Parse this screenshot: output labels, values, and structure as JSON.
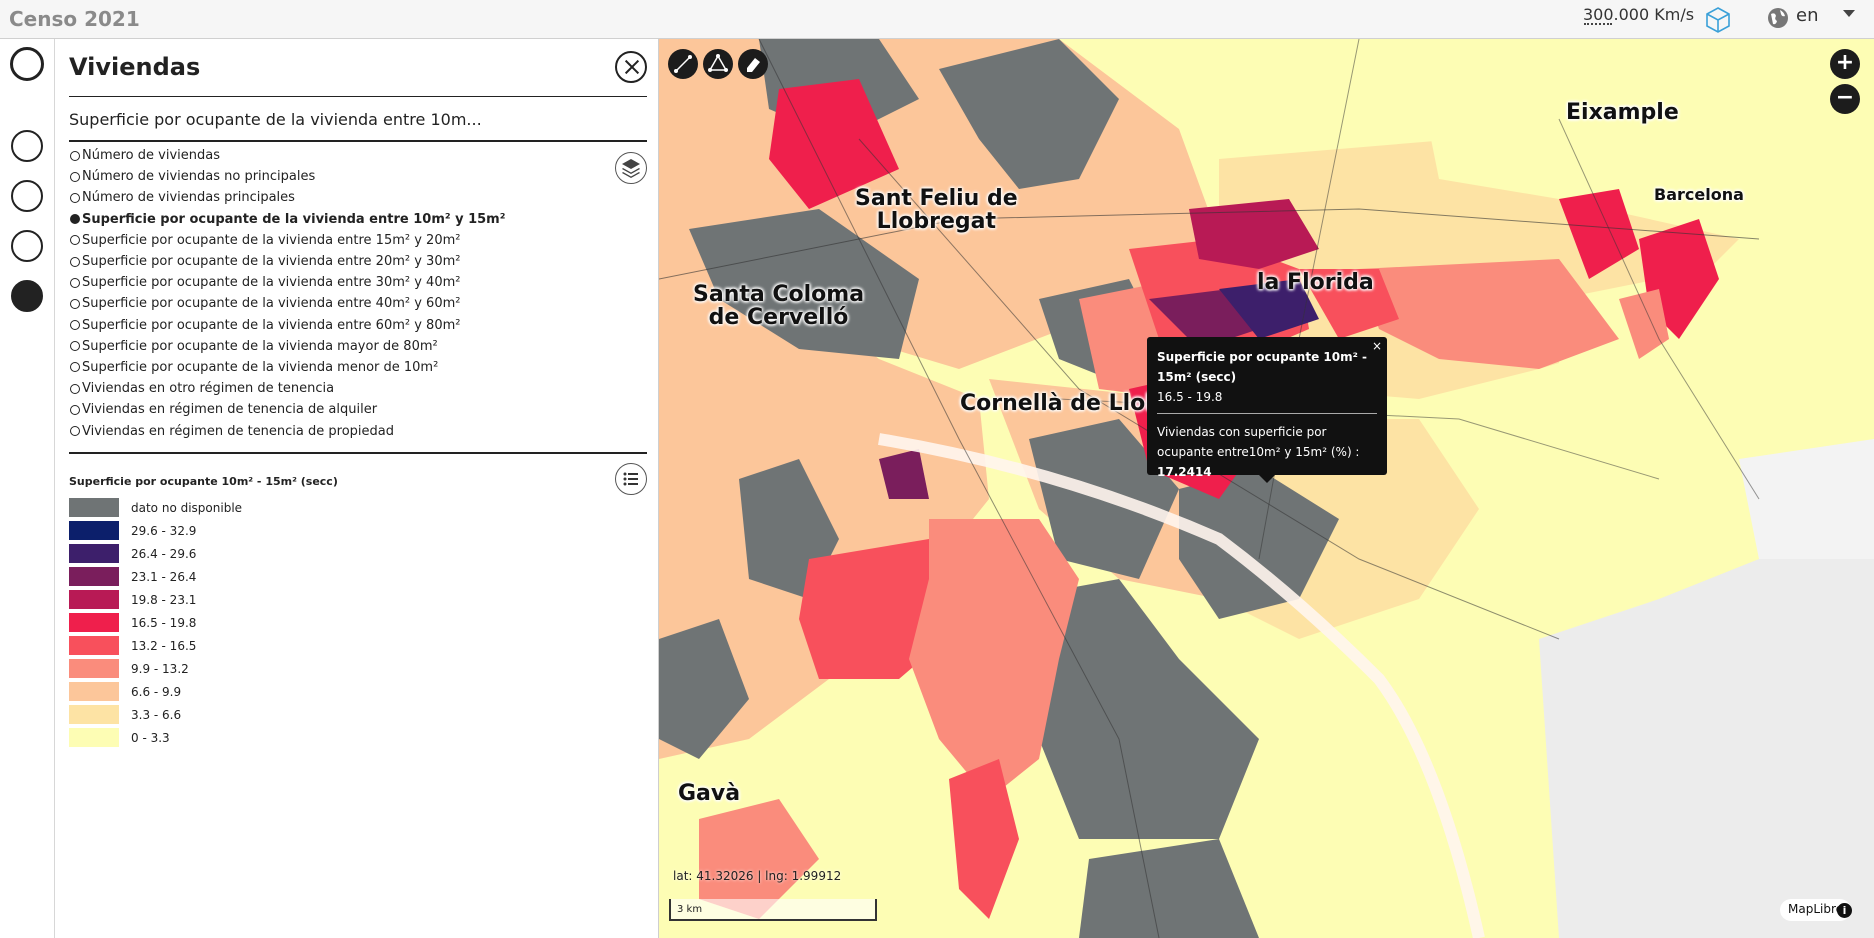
{
  "header": {
    "app_title": "Censo 2021",
    "speed": "300.000 Km/s",
    "view_3d_icon": "cube-icon",
    "language_icon": "globe-icon",
    "language": "en"
  },
  "rail": {
    "items": [
      "toggle-main",
      "section-1",
      "section-2",
      "section-3",
      "section-active"
    ]
  },
  "panel": {
    "title": "Viviendas",
    "selected_variable": "Superficie por ocupante de la vivienda entre 10m...",
    "variables": [
      {
        "label": "Número de viviendas",
        "selected": false
      },
      {
        "label": "Número de viviendas no principales",
        "selected": false
      },
      {
        "label": "Número de viviendas principales",
        "selected": false
      },
      {
        "label": "Superficie por ocupante de la vivienda entre 10m² y 15m²",
        "selected": true
      },
      {
        "label": "Superficie por ocupante de la vivienda entre 15m² y 20m²",
        "selected": false
      },
      {
        "label": "Superficie por ocupante de la vivienda entre 20m² y 30m²",
        "selected": false
      },
      {
        "label": "Superficie por ocupante de la vivienda entre 30m² y 40m²",
        "selected": false
      },
      {
        "label": "Superficie por ocupante de la vivienda entre 40m² y 60m²",
        "selected": false
      },
      {
        "label": "Superficie por ocupante de la vivienda entre 60m² y 80m²",
        "selected": false
      },
      {
        "label": "Superficie por ocupante de la vivienda mayor de 80m²",
        "selected": false
      },
      {
        "label": "Superficie por ocupante de la vivienda menor de 10m²",
        "selected": false
      },
      {
        "label": "Viviendas en otro régimen de tenencia",
        "selected": false
      },
      {
        "label": "Viviendas en régimen de tenencia de alquiler",
        "selected": false
      },
      {
        "label": "Viviendas en régimen de tenencia de propiedad",
        "selected": false
      }
    ],
    "legend_title": "Superficie por ocupante 10m² - 15m² (secc)",
    "legend": [
      {
        "label": "dato no disponible",
        "color": "#6f7475"
      },
      {
        "label": "29.6 - 32.9",
        "color": "#0c1f6b"
      },
      {
        "label": "26.4 - 29.6",
        "color": "#3d1f6b"
      },
      {
        "label": "23.1 - 26.4",
        "color": "#7a1e5c"
      },
      {
        "label": "19.8 - 23.1",
        "color": "#b81a55"
      },
      {
        "label": "16.5 - 19.8",
        "color": "#ef1f4c"
      },
      {
        "label": "13.2 - 16.5",
        "color": "#f8505c"
      },
      {
        "label": "9.9 - 13.2",
        "color": "#fa8c7c"
      },
      {
        "label": "6.6 - 9.9",
        "color": "#fcc69a"
      },
      {
        "label": "3.3 - 6.6",
        "color": "#fde3a4"
      },
      {
        "label": "0 - 3.3",
        "color": "#fdfdb4"
      }
    ]
  },
  "map": {
    "places": [
      {
        "id": "eixample",
        "label": "Eixample"
      },
      {
        "id": "barcelona",
        "label": "Barcelona"
      },
      {
        "id": "sant-feliu",
        "label": "Sant Feliu de\nLlobregat"
      },
      {
        "id": "santa-coloma",
        "label": "Santa Coloma\nde Cervelló"
      },
      {
        "id": "la-florida",
        "label": "la Florida"
      },
      {
        "id": "cornella",
        "label": "Cornellà de Llobr"
      },
      {
        "id": "gava",
        "label": "Gavà"
      }
    ],
    "popup": {
      "close": "×",
      "title": "Superficie por ocupante 10m² - 15m² (secc)",
      "range": "16.5 - 19.8",
      "description": "Viviendas con superficie por ocupante entre10m² y 15m² (%) : ",
      "value": "17.2414"
    },
    "coords": "lat: 41.32026 | lng: 1.99912",
    "scale": "3 km",
    "attribution": "MapLibre",
    "zoom_in": "+",
    "zoom_out": "−",
    "tools": [
      "line-measure-icon",
      "polygon-measure-icon",
      "eraser-icon"
    ]
  }
}
